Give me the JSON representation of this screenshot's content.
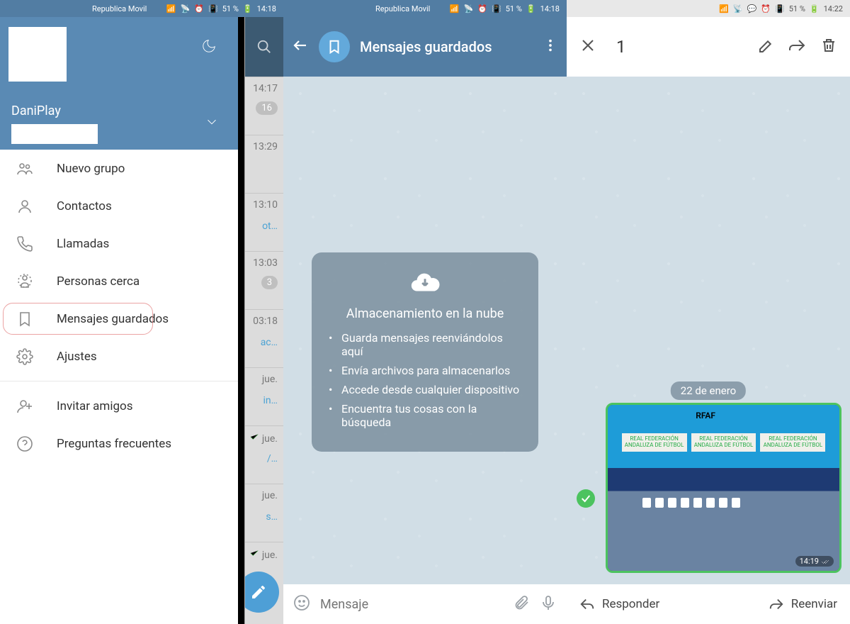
{
  "statusbar": {
    "carrier": "Republica Movil",
    "battery_text": "51 %",
    "time_left": "14:18",
    "time_right": "14:22"
  },
  "drawer": {
    "account_name": "DaniPlay",
    "items": [
      {
        "icon": "group",
        "label": "Nuevo grupo"
      },
      {
        "icon": "contact",
        "label": "Contactos"
      },
      {
        "icon": "call",
        "label": "Llamadas"
      },
      {
        "icon": "nearby",
        "label": "Personas cerca"
      },
      {
        "icon": "bookmark",
        "label": "Mensajes guardados",
        "highlight": true
      },
      {
        "icon": "settings",
        "label": "Ajustes"
      }
    ],
    "items2": [
      {
        "icon": "invite",
        "label": "Invitar amigos"
      },
      {
        "icon": "faq",
        "label": "Preguntas frecuentes"
      }
    ]
  },
  "chat_strip": [
    {
      "time": "14:17",
      "badge": "16",
      "snippet": ""
    },
    {
      "time": "13:29",
      "snippet": ""
    },
    {
      "time": "13:10",
      "snippet": "ot…"
    },
    {
      "time": "13:03",
      "badge": "3",
      "snippet": ""
    },
    {
      "time": "03:18",
      "snippet": "ac…"
    },
    {
      "time": "jue.",
      "snippet": "in…"
    },
    {
      "time": "jue.",
      "snippet": "/…",
      "checked": true
    },
    {
      "time": "jue.",
      "snippet": "s…"
    },
    {
      "time": "jue.",
      "snippet": "",
      "checked": true
    }
  ],
  "chat2": {
    "title": "Mensajes guardados",
    "cloud_title": "Almacenamiento en la nube",
    "cloud_items": [
      "Guarda mensajes reenviándolos aquí",
      "Envía archivos para almacenarlos",
      "Accede desde cualquier dispositivo",
      "Encuentra tus cosas con la búsqueda"
    ],
    "placeholder": "Mensaje"
  },
  "panel3": {
    "selection_count": "1",
    "date_pill": "22 de enero",
    "photo": {
      "banner_top": "RFAF",
      "banner_text": "REAL FEDERACIÓN ANDALUZA DE FÚTBOL",
      "timestamp": "14:19"
    },
    "reply_label": "Responder",
    "forward_label": "Reenviar"
  }
}
